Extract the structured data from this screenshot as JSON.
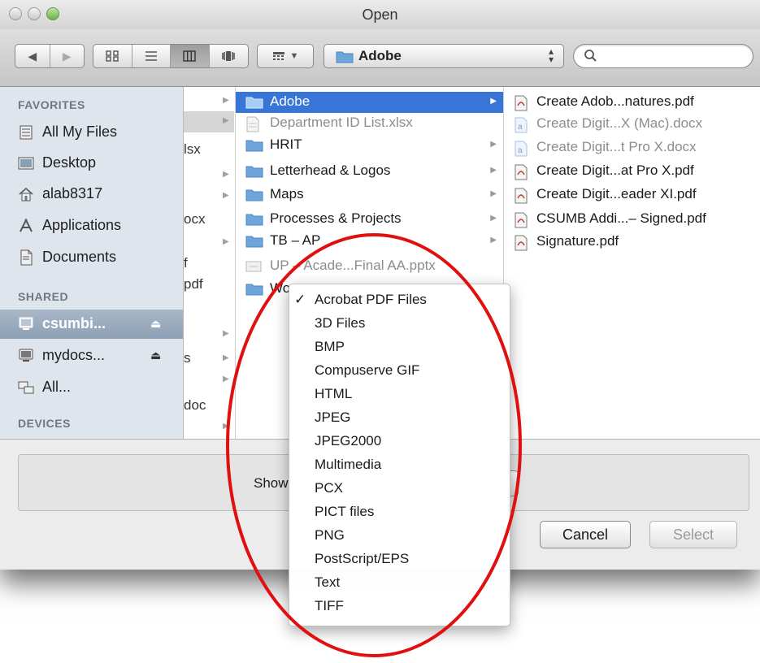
{
  "window": {
    "title": "Open"
  },
  "toolbar": {
    "path": "Adobe",
    "view_icons": [
      "icon-view-icon",
      "list-view-icon",
      "column-view-icon",
      "coverflow-view-icon"
    ]
  },
  "sidebar": {
    "favorites_header": "FAVORITES",
    "favorites": [
      {
        "label": "All My Files",
        "icon": "all-files-icon"
      },
      {
        "label": "Desktop",
        "icon": "desktop-icon"
      },
      {
        "label": "alab8317",
        "icon": "home-icon"
      },
      {
        "label": "Applications",
        "icon": "applications-icon"
      },
      {
        "label": "Documents",
        "icon": "documents-icon"
      }
    ],
    "shared_header": "SHARED",
    "shared": [
      {
        "label": "csumbi...",
        "icon": "network-drive-icon"
      },
      {
        "label": "mydocs...",
        "icon": "network-drive-icon"
      },
      {
        "label": "All...",
        "icon": "network-icon"
      }
    ],
    "devices_header": "DEVICES"
  },
  "column1_fragments": [
    "lsx",
    "ocx",
    "f",
    "pdf",
    "s",
    "doc"
  ],
  "column2": [
    {
      "name": "Adobe"
    },
    {
      "name": "Department ID List.xlsx"
    },
    {
      "name": "HRIT"
    },
    {
      "name": "Letterhead & Logos"
    },
    {
      "name": "Maps"
    },
    {
      "name": "Processes & Projects"
    },
    {
      "name": "TB – AP"
    },
    {
      "name": "UP – Acade...Final AA.pptx"
    },
    {
      "name": "Wo"
    }
  ],
  "column3": [
    {
      "name": "Create Adob...natures.pdf"
    },
    {
      "name": "Create Digit...X (Mac).docx"
    },
    {
      "name": "Create Digit...t Pro X.docx"
    },
    {
      "name": "Create Digit...at Pro X.pdf"
    },
    {
      "name": "Create Digit...eader XI.pdf"
    },
    {
      "name": "CSUMB Addi...– Signed.pdf"
    },
    {
      "name": "Signature.pdf"
    }
  ],
  "options": {
    "show_label": "Show"
  },
  "buttons": {
    "cancel": "Cancel",
    "select": "Select"
  },
  "format_menu": {
    "selected_mark": "✓",
    "items": [
      "Acrobat PDF Files",
      "3D Files",
      "BMP",
      "Compuserve GIF",
      "HTML",
      "JPEG",
      "JPEG2000",
      "Multimedia",
      "PCX",
      "PICT files",
      "PNG",
      "PostScript/EPS",
      "Text",
      "TIFF"
    ]
  },
  "colors": {
    "selection": "#3875d7",
    "annotation": "#e01010",
    "sidebar_selected": "#8ea0b5"
  }
}
